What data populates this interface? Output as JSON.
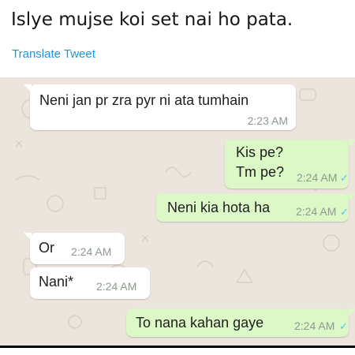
{
  "tweet": {
    "text": "Islye mujse koi set nai ho pata.",
    "translate_label": "Translate Tweet"
  },
  "chat": {
    "background_color": "#ece5dd",
    "incoming_color": "#ffffff",
    "outgoing_color": "#dcf8c6",
    "read_tick_color": "#4fc3f7",
    "messages": [
      {
        "direction": "incoming",
        "line1": "Neni jan pr zra pyr ni ata tumhain",
        "time": "2:23 AM"
      },
      {
        "direction": "outgoing",
        "line1": "Kis pe?",
        "line2": "Tm pe?",
        "time": "2:24 AM",
        "status": "read"
      },
      {
        "direction": "outgoing",
        "line1": "Neni kia hota ha",
        "time": "2:24 AM",
        "status": "read"
      },
      {
        "direction": "incoming",
        "line1": "Or",
        "time": "2:24 AM"
      },
      {
        "direction": "incoming",
        "line1": "Nani*",
        "time": "2:24 AM"
      },
      {
        "direction": "outgoing",
        "line1": "To nana kahan gaye",
        "time": "2:24 AM",
        "status": "read"
      }
    ],
    "tick_glyph": "✓"
  }
}
